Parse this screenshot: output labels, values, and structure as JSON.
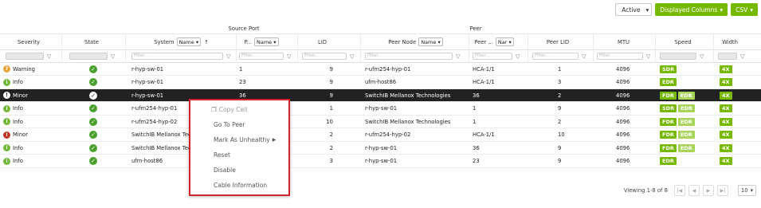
{
  "toolbar": {
    "active_select": "Active",
    "displayed_columns": "Displayed Columns",
    "csv": "CSV"
  },
  "groups": {
    "source_port": "Source Port",
    "peer": "Peer"
  },
  "headers": {
    "severity": "Severity",
    "state": "State",
    "system": "System",
    "system_select": "Name",
    "port": "P...",
    "port_select": "Name",
    "lid": "LID",
    "peer_node": "Peer Node",
    "peer_node_select": "Name",
    "peer_port": "Peer ...",
    "peer_port_select": "Nar",
    "peer_lid": "Peer LID",
    "mtu": "MTU",
    "speed": "Speed",
    "width": "Width",
    "sort_arrow": "↑"
  },
  "filter_placeholder": "Filter...",
  "rows": [
    {
      "severity": "Warning",
      "sev_type": "warning",
      "system": "r-hyp-sw-01",
      "port": "1",
      "lid": "9",
      "peer_node": "r-ufm254-hyp-01",
      "peer_port": "HCA-1/1",
      "peer_lid": "1",
      "mtu": "4096",
      "speed": [
        "SDR"
      ],
      "width": "4X",
      "selected": false
    },
    {
      "severity": "Info",
      "sev_type": "info",
      "system": "r-hyp-sw-01",
      "port": "23",
      "lid": "9",
      "peer_node": "ufm-host86",
      "peer_port": "HCA-1/1",
      "peer_lid": "3",
      "mtu": "4096",
      "speed": [
        "EDR"
      ],
      "width": "4X",
      "selected": false
    },
    {
      "severity": "Minor",
      "sev_type": "minor-dark",
      "system": "r-hyp-sw-01",
      "port": "36",
      "lid": "9",
      "peer_node": "SwitchIB Mellanox Technologies",
      "peer_port": "36",
      "peer_lid": "2",
      "mtu": "4096",
      "speed": [
        "FDR",
        "EDR"
      ],
      "width": "4X",
      "selected": true
    },
    {
      "severity": "Info",
      "sev_type": "info",
      "system": "r-ufm254-hyp-01",
      "port": "",
      "lid": "1",
      "peer_node": "r-hyp-sw-01",
      "peer_port": "1",
      "peer_lid": "9",
      "mtu": "4096",
      "speed": [
        "SDR",
        "EDR"
      ],
      "width": "4X",
      "selected": false
    },
    {
      "severity": "Info",
      "sev_type": "info",
      "system": "r-ufm254-hyp-02",
      "port": "",
      "lid": "10",
      "peer_node": "SwitchIB Mellanox Technologies",
      "peer_port": "1",
      "peer_lid": "2",
      "mtu": "4096",
      "speed": [
        "FDR",
        "EDR"
      ],
      "width": "4X",
      "selected": false
    },
    {
      "severity": "Minor",
      "sev_type": "minor",
      "system": "SwitchIB Mellanox Tec",
      "port": "",
      "lid": "2",
      "peer_node": "r-ufm254-hyp-02",
      "peer_port": "HCA-1/1",
      "peer_lid": "10",
      "mtu": "4096",
      "speed": [
        "FDR",
        "EDR"
      ],
      "width": "4X",
      "selected": false
    },
    {
      "severity": "Info",
      "sev_type": "info",
      "system": "SwitchIB Mellanox Tec",
      "port": "",
      "lid": "2",
      "peer_node": "r-hyp-sw-01",
      "peer_port": "36",
      "peer_lid": "9",
      "mtu": "4096",
      "speed": [
        "FDR",
        "EDR"
      ],
      "width": "4X",
      "selected": false
    },
    {
      "severity": "Info",
      "sev_type": "info",
      "system": "ufm-host86",
      "port": "",
      "lid": "3",
      "peer_node": "r-hyp-sw-01",
      "peer_port": "23",
      "peer_lid": "9",
      "mtu": "4096",
      "speed": [
        "EDR"
      ],
      "width": "4X",
      "selected": false
    }
  ],
  "context_menu": {
    "copy_cell": "Copy Cell",
    "go_to_peer": "Go To Peer",
    "mark_unhealthy": "Mark As Unhealthy",
    "reset": "Reset",
    "disable": "Disable",
    "cable_information": "Cable Information"
  },
  "pager": {
    "viewing": "Viewing 1-8 of 8",
    "page_size": "10"
  },
  "colors": {
    "accent": "#76b900",
    "highlight_border": "#d1262c",
    "selected_row": "#222222"
  }
}
